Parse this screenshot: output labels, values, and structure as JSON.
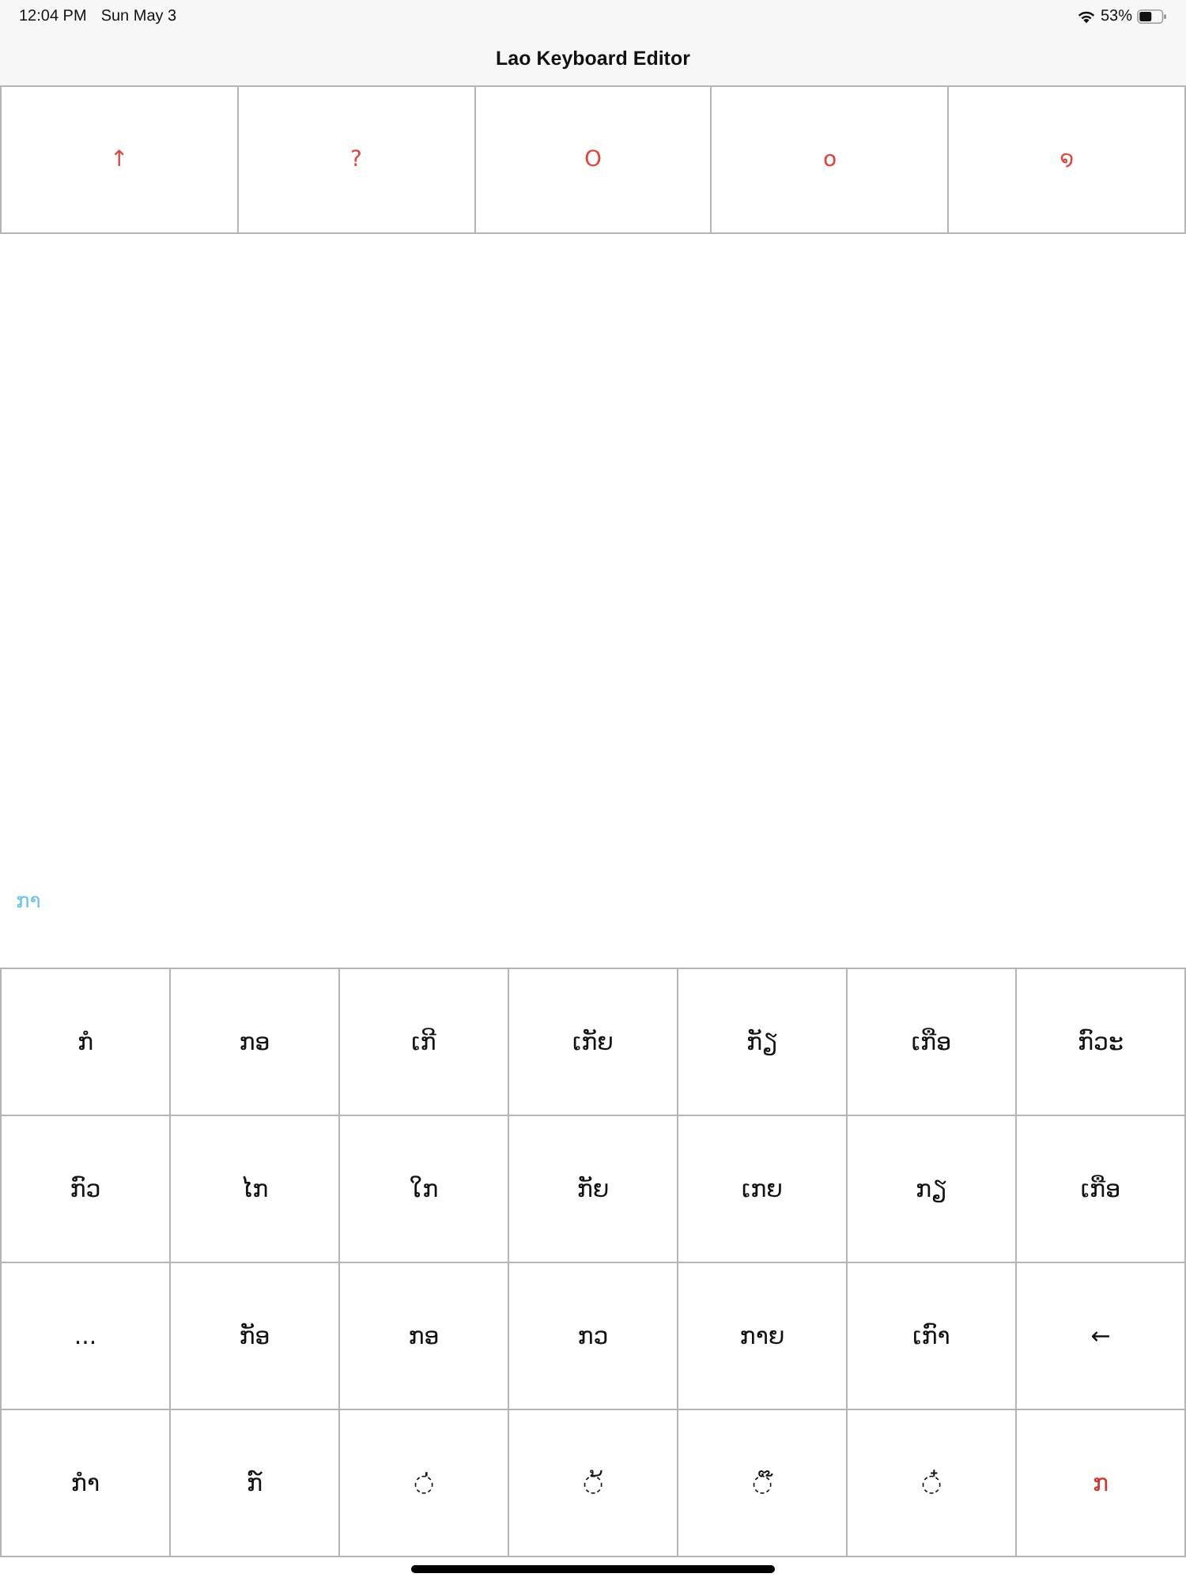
{
  "status_bar": {
    "time": "12:04 PM",
    "date": "Sun May 3",
    "battery": "53%"
  },
  "nav_bar": {
    "title": "Lao Keyboard Editor"
  },
  "top_keys": [
    {
      "label": "↑"
    },
    {
      "label": "?"
    },
    {
      "label": "O"
    },
    {
      "label": "໐"
    },
    {
      "label": "໑"
    }
  ],
  "preview": {
    "text": "ກາ"
  },
  "keyboard": {
    "rows": [
      {
        "keys": [
          {
            "label": "ກໍ",
            "selected": false
          },
          {
            "label": "ກອ",
            "selected": false
          },
          {
            "label": "ເກີ",
            "selected": false
          },
          {
            "label": "ເກັຍ",
            "selected": false
          },
          {
            "label": "ກັຽ",
            "selected": false
          },
          {
            "label": "ເກືອ",
            "selected": false
          },
          {
            "label": "ກົວະ",
            "selected": false
          }
        ]
      },
      {
        "keys": [
          {
            "label": "ກົວ",
            "selected": false
          },
          {
            "label": "ໄກ",
            "selected": false
          },
          {
            "label": "ໃກ",
            "selected": false
          },
          {
            "label": "ກັຍ",
            "selected": false
          },
          {
            "label": "ເກຍ",
            "selected": false
          },
          {
            "label": "ກຽ",
            "selected": false
          },
          {
            "label": "ເກືອ",
            "selected": false
          }
        ]
      },
      {
        "keys": [
          {
            "label": "...",
            "selected": false
          },
          {
            "label": "ກັອ",
            "selected": false
          },
          {
            "label": "ກອ",
            "selected": false
          },
          {
            "label": "ກວ",
            "selected": false
          },
          {
            "label": "ກາຍ",
            "selected": false
          },
          {
            "label": "ເກົາ",
            "selected": false
          },
          {
            "label": "←",
            "selected": false
          }
        ]
      },
      {
        "keys": [
          {
            "label": "ກຳ",
            "selected": false
          },
          {
            "label": "ກ໌",
            "selected": false
          },
          {
            "label": "◌່",
            "selected": false
          },
          {
            "label": "◌້",
            "selected": false
          },
          {
            "label": "◌໊",
            "selected": false
          },
          {
            "label": "◌໋",
            "selected": false
          },
          {
            "label": "ກ",
            "selected": true
          }
        ]
      }
    ]
  }
}
